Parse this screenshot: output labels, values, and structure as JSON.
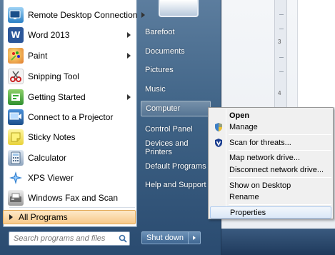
{
  "start_menu": {
    "programs": [
      {
        "label": "Remote Desktop Connection",
        "icon": "remote-desktop-icon",
        "has_arrow": true
      },
      {
        "label": "Word 2013",
        "icon": "word-icon",
        "has_arrow": true
      },
      {
        "label": "Paint",
        "icon": "paint-icon",
        "has_arrow": true
      },
      {
        "label": "Snipping Tool",
        "icon": "snipping-tool-icon",
        "has_arrow": false
      },
      {
        "label": "Getting Started",
        "icon": "getting-started-icon",
        "has_arrow": true
      },
      {
        "label": "Connect to a Projector",
        "icon": "projector-icon",
        "has_arrow": false
      },
      {
        "label": "Sticky Notes",
        "icon": "sticky-notes-icon",
        "has_arrow": false
      },
      {
        "label": "Calculator",
        "icon": "calculator-icon",
        "has_arrow": false
      },
      {
        "label": "XPS Viewer",
        "icon": "xps-viewer-icon",
        "has_arrow": false
      },
      {
        "label": "Windows Fax and Scan",
        "icon": "fax-scan-icon",
        "has_arrow": false
      }
    ],
    "all_programs_label": "All Programs",
    "search_placeholder": "Search programs and files",
    "right_items": [
      {
        "label": "Barefoot"
      },
      {
        "label": "Documents"
      },
      {
        "label": "Pictures"
      },
      {
        "label": "Music"
      },
      {
        "label": "Computer"
      },
      {
        "label": "Control Panel"
      },
      {
        "label": "Devices and Printers"
      },
      {
        "label": "Default Programs"
      },
      {
        "label": "Help and Support"
      }
    ],
    "shutdown_label": "Shut down"
  },
  "context_menu": {
    "items": [
      {
        "label": "Open",
        "bold": true
      },
      {
        "label": "Manage",
        "icon": "uac-shield-icon"
      },
      {
        "label": "Scan for threats...",
        "icon": "antivirus-icon"
      },
      {
        "label": "Map network drive..."
      },
      {
        "label": "Disconnect network drive..."
      },
      {
        "label": "Show on Desktop"
      },
      {
        "label": "Rename"
      },
      {
        "label": "Properties"
      }
    ]
  },
  "ruler": {
    "numbers": [
      "3",
      "4"
    ]
  },
  "colors": {
    "highlight": "#f7c98a",
    "menu_blue": "#3f6386",
    "context_hover": "#dbe8f7"
  }
}
